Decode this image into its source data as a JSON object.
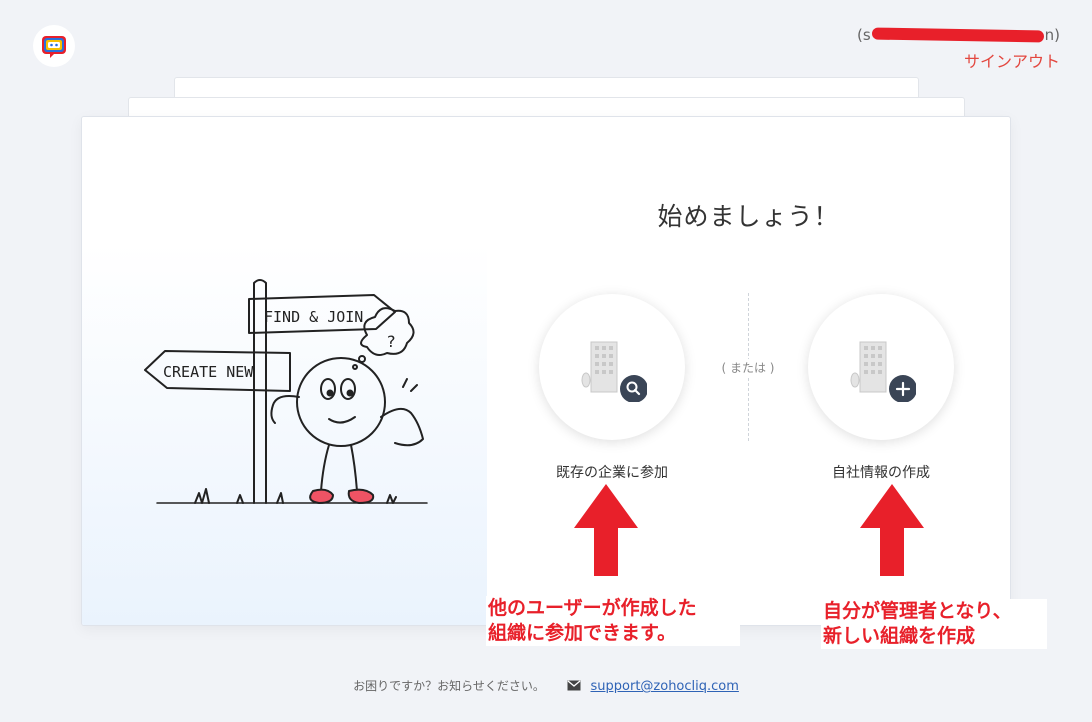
{
  "header": {
    "email_prefix": "(s",
    "email_suffix": "n)",
    "signout_label": "サインアウト"
  },
  "main": {
    "title": "始めましょう！",
    "or_text": "( または )",
    "join_label": "既存の企業に参加",
    "create_label": "自社情報の作成"
  },
  "illustration": {
    "sign_find": "FIND & JOIN",
    "sign_create": "CREATE NEW"
  },
  "footer": {
    "help_text": "お困りですか？お知らせください。",
    "support_email": "support@zohocliq.com"
  },
  "annotations": {
    "note_join_line1": "他のユーザーが作成した",
    "note_join_line2": "組織に参加できます。",
    "note_create_line1": "自分が管理者となり、",
    "note_create_line2": "新しい組織を作成"
  },
  "colors": {
    "accent_red": "#e3473f",
    "annotation_red": "#e8202a",
    "link_blue": "#2f63b6"
  }
}
